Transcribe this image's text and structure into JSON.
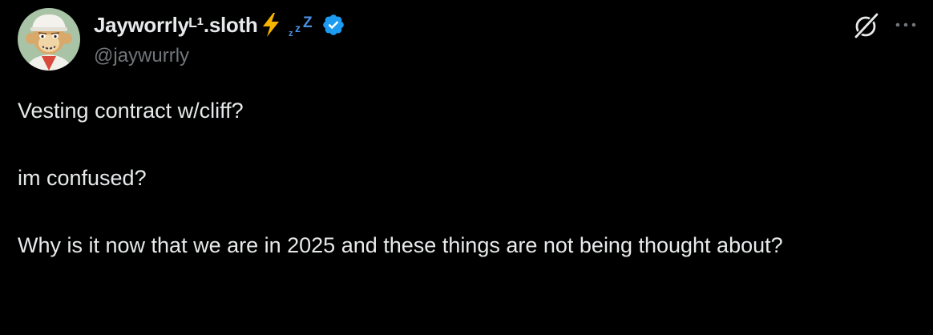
{
  "author": {
    "display_name": "Jayworrlyᴸ¹.sloth",
    "handle": "@jaywurrly",
    "badges": [
      "bolt-icon",
      "zzz-icon",
      "verified-icon"
    ]
  },
  "actions": {
    "grok_icon": "grok-icon",
    "more_icon": "more-icon"
  },
  "tweet": {
    "lines": [
      "Vesting contract w/cliff?",
      "im confused?",
      "Why is it now that we are in 2025 and these things are not being thought about?"
    ]
  },
  "colors": {
    "background": "#000000",
    "text": "#e7e9ea",
    "secondary_text": "#71767b",
    "verified_blue": "#1d9bf0",
    "bolt_yellow": "#f5b400"
  }
}
